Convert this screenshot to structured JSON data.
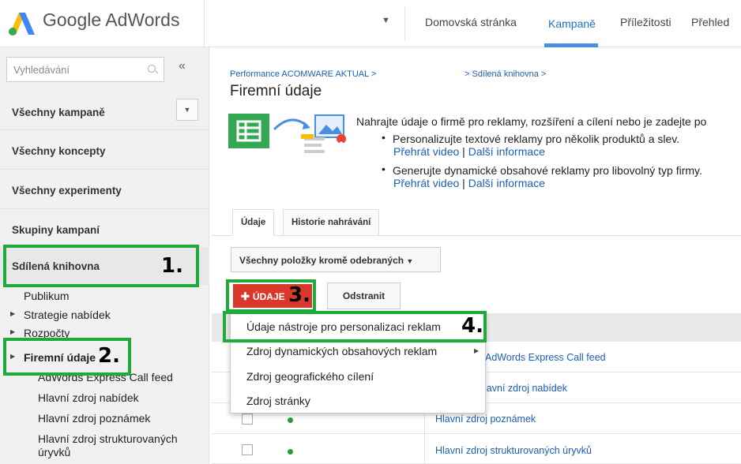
{
  "header": {
    "brand": "Google AdWords",
    "nav": [
      "Domovská stránka",
      "Kampaně",
      "Příležitosti",
      "Přehled"
    ],
    "active_tab": "Kampaně",
    "accent": "#4a90e2"
  },
  "sidebar": {
    "search_placeholder": "Vyhledávání",
    "collapse": "«",
    "items": [
      "Všechny kampaně",
      "Všechny koncepty",
      "Všechny experimenty",
      "Skupiny kampaní",
      "Sdílená knihovna"
    ],
    "sub_items": [
      "Publikum",
      "Strategie nabídek",
      "Rozpočty",
      "Firemní údaje"
    ],
    "sub2_items": [
      "AdWords Express Call feed",
      "Hlavní zdroj nabídek",
      "Hlavní zdroj poznámek",
      "Hlavní zdroj strukturovaných",
      "úryvků"
    ]
  },
  "annotations": [
    "1.",
    "2.",
    "3.",
    "4."
  ],
  "main": {
    "crumb1": "Performance ACOMWARE AKTUAL >",
    "crumb2": "> Sdílená knihovna >",
    "title": "Firemní údaje",
    "description": "Nahrajte údaje o firmě pro reklamy, rozšíření a cílení nebo je zadejte po",
    "bullet1": "Personalizujte textové reklamy pro několik produktů a slev.",
    "bullet2": "Generujte dynamické obsahové reklamy pro libovolný typ firmy.",
    "link_video": "Přehrát video",
    "link_sep": " | ",
    "link_more": "Další informace",
    "tabs": [
      "Údaje",
      "Historie nahrávání"
    ],
    "filter_label": "Všechny položky kromě odebraných",
    "add_button": "ÚDAJE",
    "delete_button": "Odstranit",
    "rows": [
      "AdWords Express Call feed",
      "Hlavní zdroj nabídek",
      "Hlavní zdroj poznámek",
      "Hlavní zdroj strukturovaných úryvků"
    ],
    "status_color": "#1e9e3b"
  },
  "menu": {
    "items": [
      "Údaje nástroje pro personalizaci reklam",
      "Zdroj dynamických obsahových reklam",
      "Zdroj geografického cílení",
      "Zdroj stránky"
    ]
  }
}
